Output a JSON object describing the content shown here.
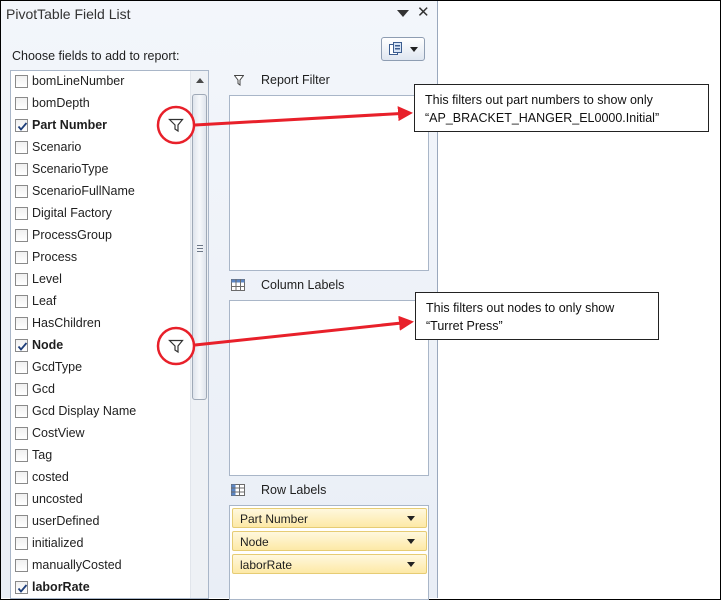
{
  "window": {
    "title": "PivotTable Field List"
  },
  "field_section": {
    "prompt": "Choose fields to add to report:",
    "fields": [
      {
        "label": "bomLineNumber",
        "checked": false,
        "bold": false
      },
      {
        "label": "bomDepth",
        "checked": false,
        "bold": false
      },
      {
        "label": "Part Number",
        "checked": true,
        "bold": true,
        "filtered": true
      },
      {
        "label": "Scenario",
        "checked": false,
        "bold": false
      },
      {
        "label": "ScenarioType",
        "checked": false,
        "bold": false
      },
      {
        "label": "ScenarioFullName",
        "checked": false,
        "bold": false
      },
      {
        "label": "Digital Factory",
        "checked": false,
        "bold": false
      },
      {
        "label": "ProcessGroup",
        "checked": false,
        "bold": false
      },
      {
        "label": "Process",
        "checked": false,
        "bold": false
      },
      {
        "label": "Level",
        "checked": false,
        "bold": false
      },
      {
        "label": "Leaf",
        "checked": false,
        "bold": false
      },
      {
        "label": "HasChildren",
        "checked": false,
        "bold": false
      },
      {
        "label": "Node",
        "checked": true,
        "bold": true,
        "filtered": true
      },
      {
        "label": "GcdType",
        "checked": false,
        "bold": false
      },
      {
        "label": "Gcd",
        "checked": false,
        "bold": false
      },
      {
        "label": "Gcd Display Name",
        "checked": false,
        "bold": false
      },
      {
        "label": "CostView",
        "checked": false,
        "bold": false
      },
      {
        "label": "Tag",
        "checked": false,
        "bold": false
      },
      {
        "label": "costed",
        "checked": false,
        "bold": false
      },
      {
        "label": "uncosted",
        "checked": false,
        "bold": false
      },
      {
        "label": "userDefined",
        "checked": false,
        "bold": false
      },
      {
        "label": "initialized",
        "checked": false,
        "bold": false
      },
      {
        "label": "manuallyCosted",
        "checked": false,
        "bold": false
      },
      {
        "label": "laborRate",
        "checked": true,
        "bold": true
      }
    ]
  },
  "areas": {
    "report_filter": "Report Filter",
    "column_labels": "Column Labels",
    "row_labels": "Row Labels",
    "row_items": [
      "Part Number",
      "Node",
      "laborRate"
    ]
  },
  "callouts": {
    "part_number": [
      "This filters out part numbers to show only",
      "“AP_BRACKET_HANGER_EL0000.Initial”"
    ],
    "node": [
      "This filters out nodes to only show",
      "“Turret Press”"
    ]
  },
  "colors": {
    "annotation": "#e8202a",
    "row_item_fill": "#fde9a6",
    "pane_bg": "#e9eef6"
  },
  "icons": {
    "filter": "funnel-icon",
    "column": "column-grid-icon",
    "row": "row-grid-icon",
    "layout": "field-layout-icon"
  }
}
